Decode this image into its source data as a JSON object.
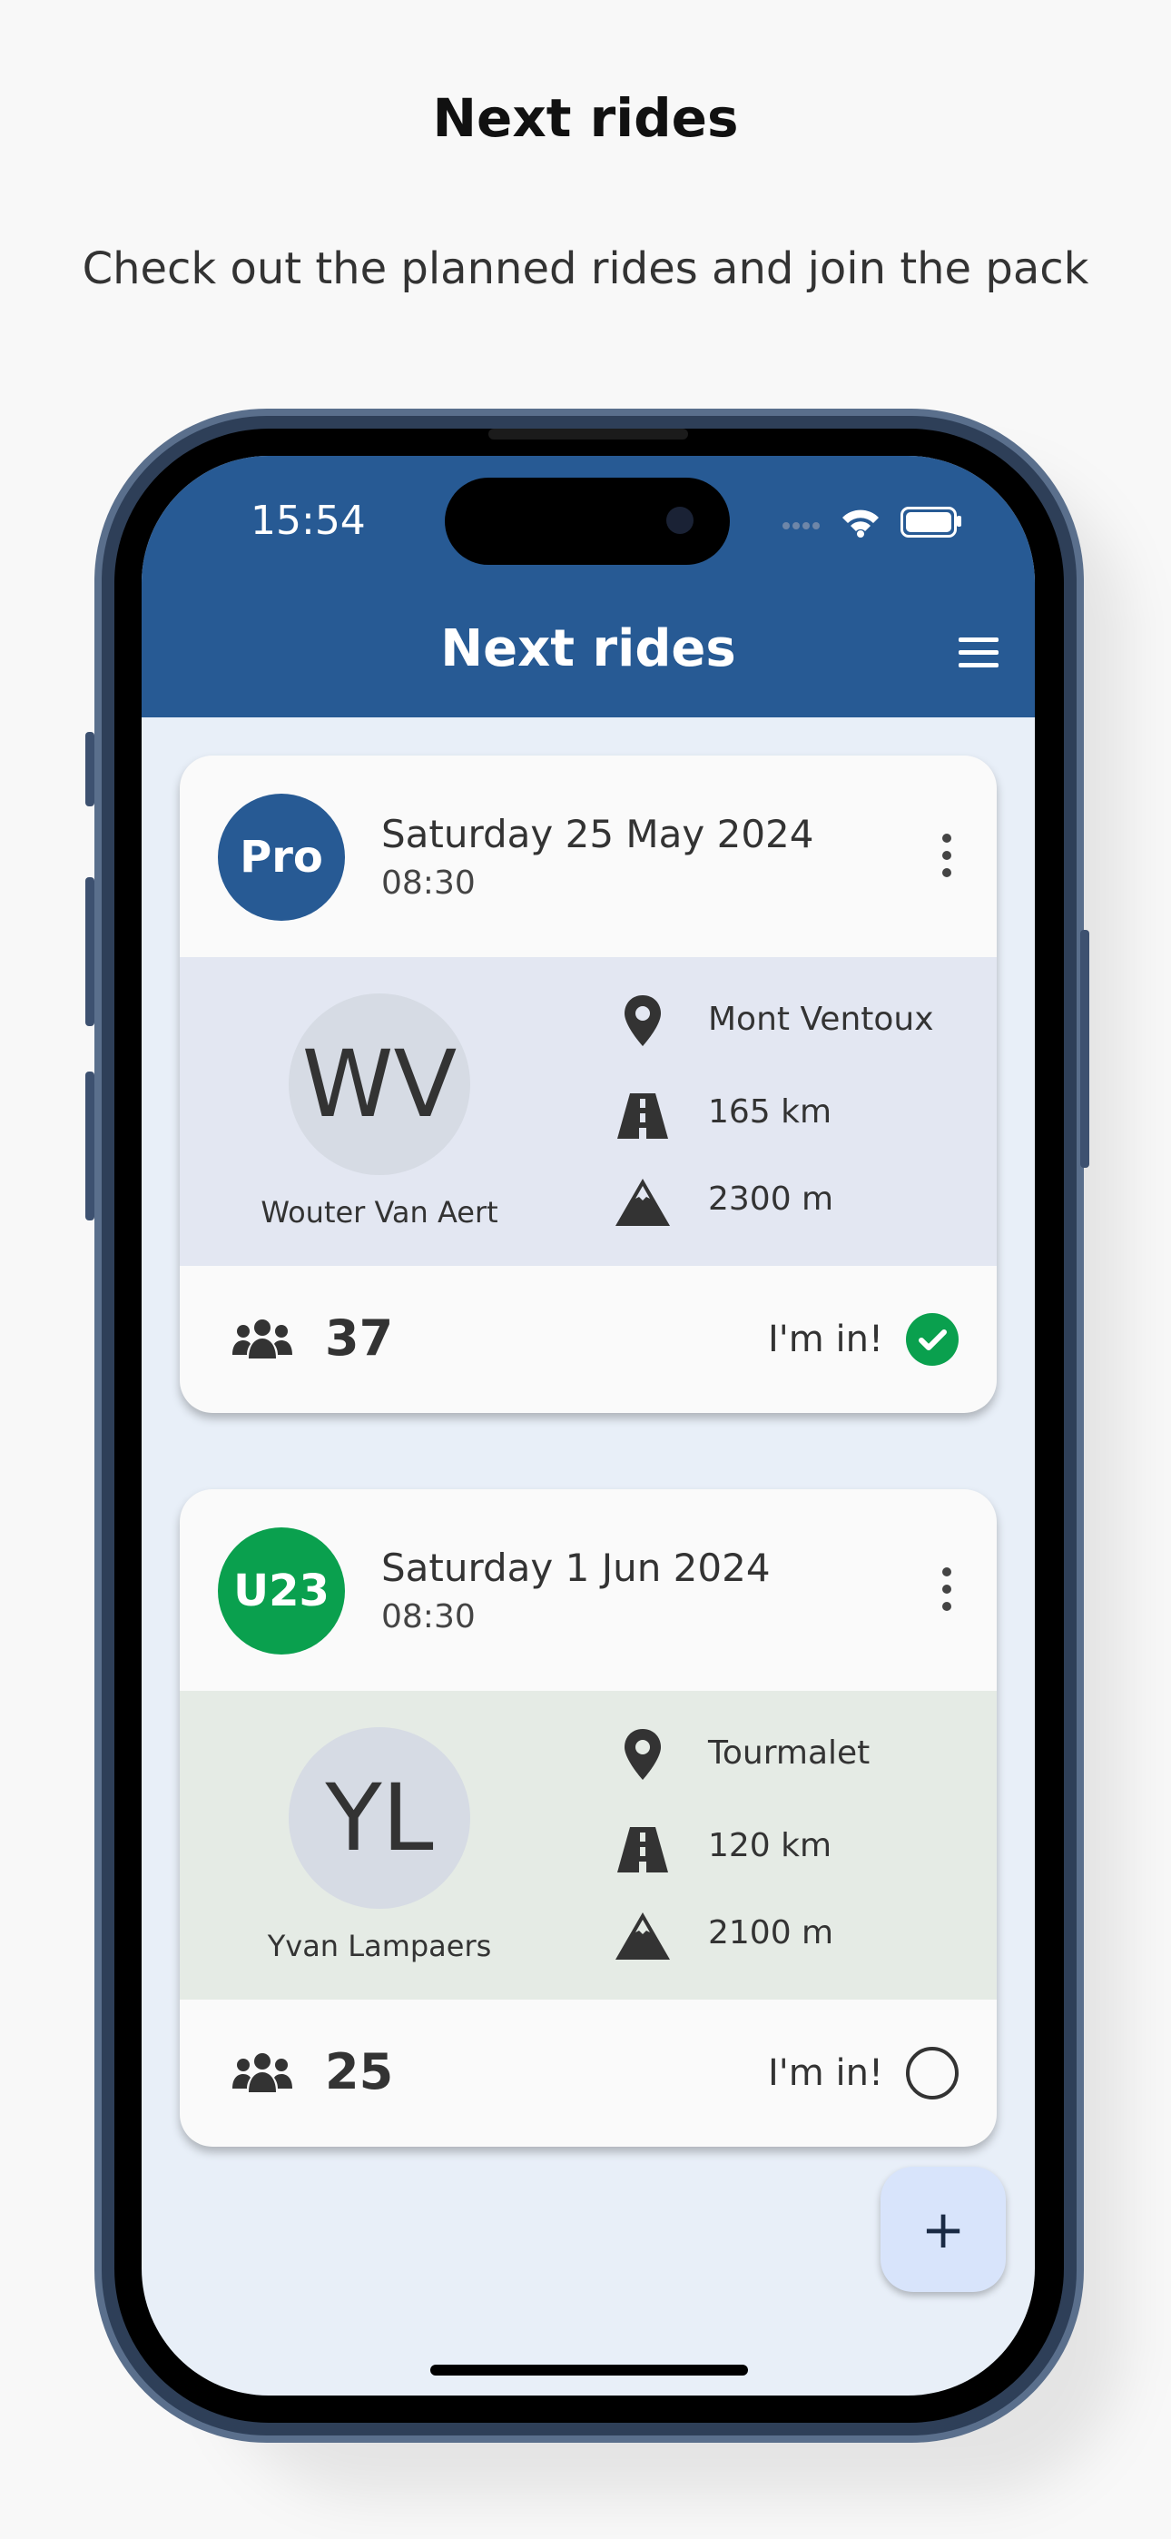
{
  "header": {
    "title": "Next rides",
    "subtitle": "Check out the planned rides and join the pack"
  },
  "status_bar": {
    "time": "15:54"
  },
  "app_bar": {
    "title": "Next rides",
    "menu_icon": "hamburger-menu-icon"
  },
  "rides": [
    {
      "level": "Pro",
      "level_color": "#275a94",
      "date": "Saturday 25 May 2024",
      "time": "08:30",
      "body_color": "#e3e7f2",
      "leader_initials": "WV",
      "leader_name": "Wouter Van Aert",
      "location": "Mont Ventoux",
      "distance": "165 km",
      "elevation": "2300 m",
      "riders": "37",
      "im_in_label": "I'm in!",
      "joined": true
    },
    {
      "level": "U23",
      "level_color": "#0aa04e",
      "date": "Saturday 1 Jun 2024",
      "time": "08:30",
      "body_color": "#e5ebe5",
      "leader_initials": "YL",
      "leader_name": "Yvan Lampaers",
      "location": "Tourmalet",
      "distance": "120 km",
      "elevation": "2100 m",
      "riders": "25",
      "im_in_label": "I'm in!",
      "joined": false
    }
  ],
  "fab": {
    "label": "+"
  },
  "colors": {
    "primary": "#275a94",
    "screen_background": "#e8eff8",
    "joined_check": "#0aa04e"
  }
}
